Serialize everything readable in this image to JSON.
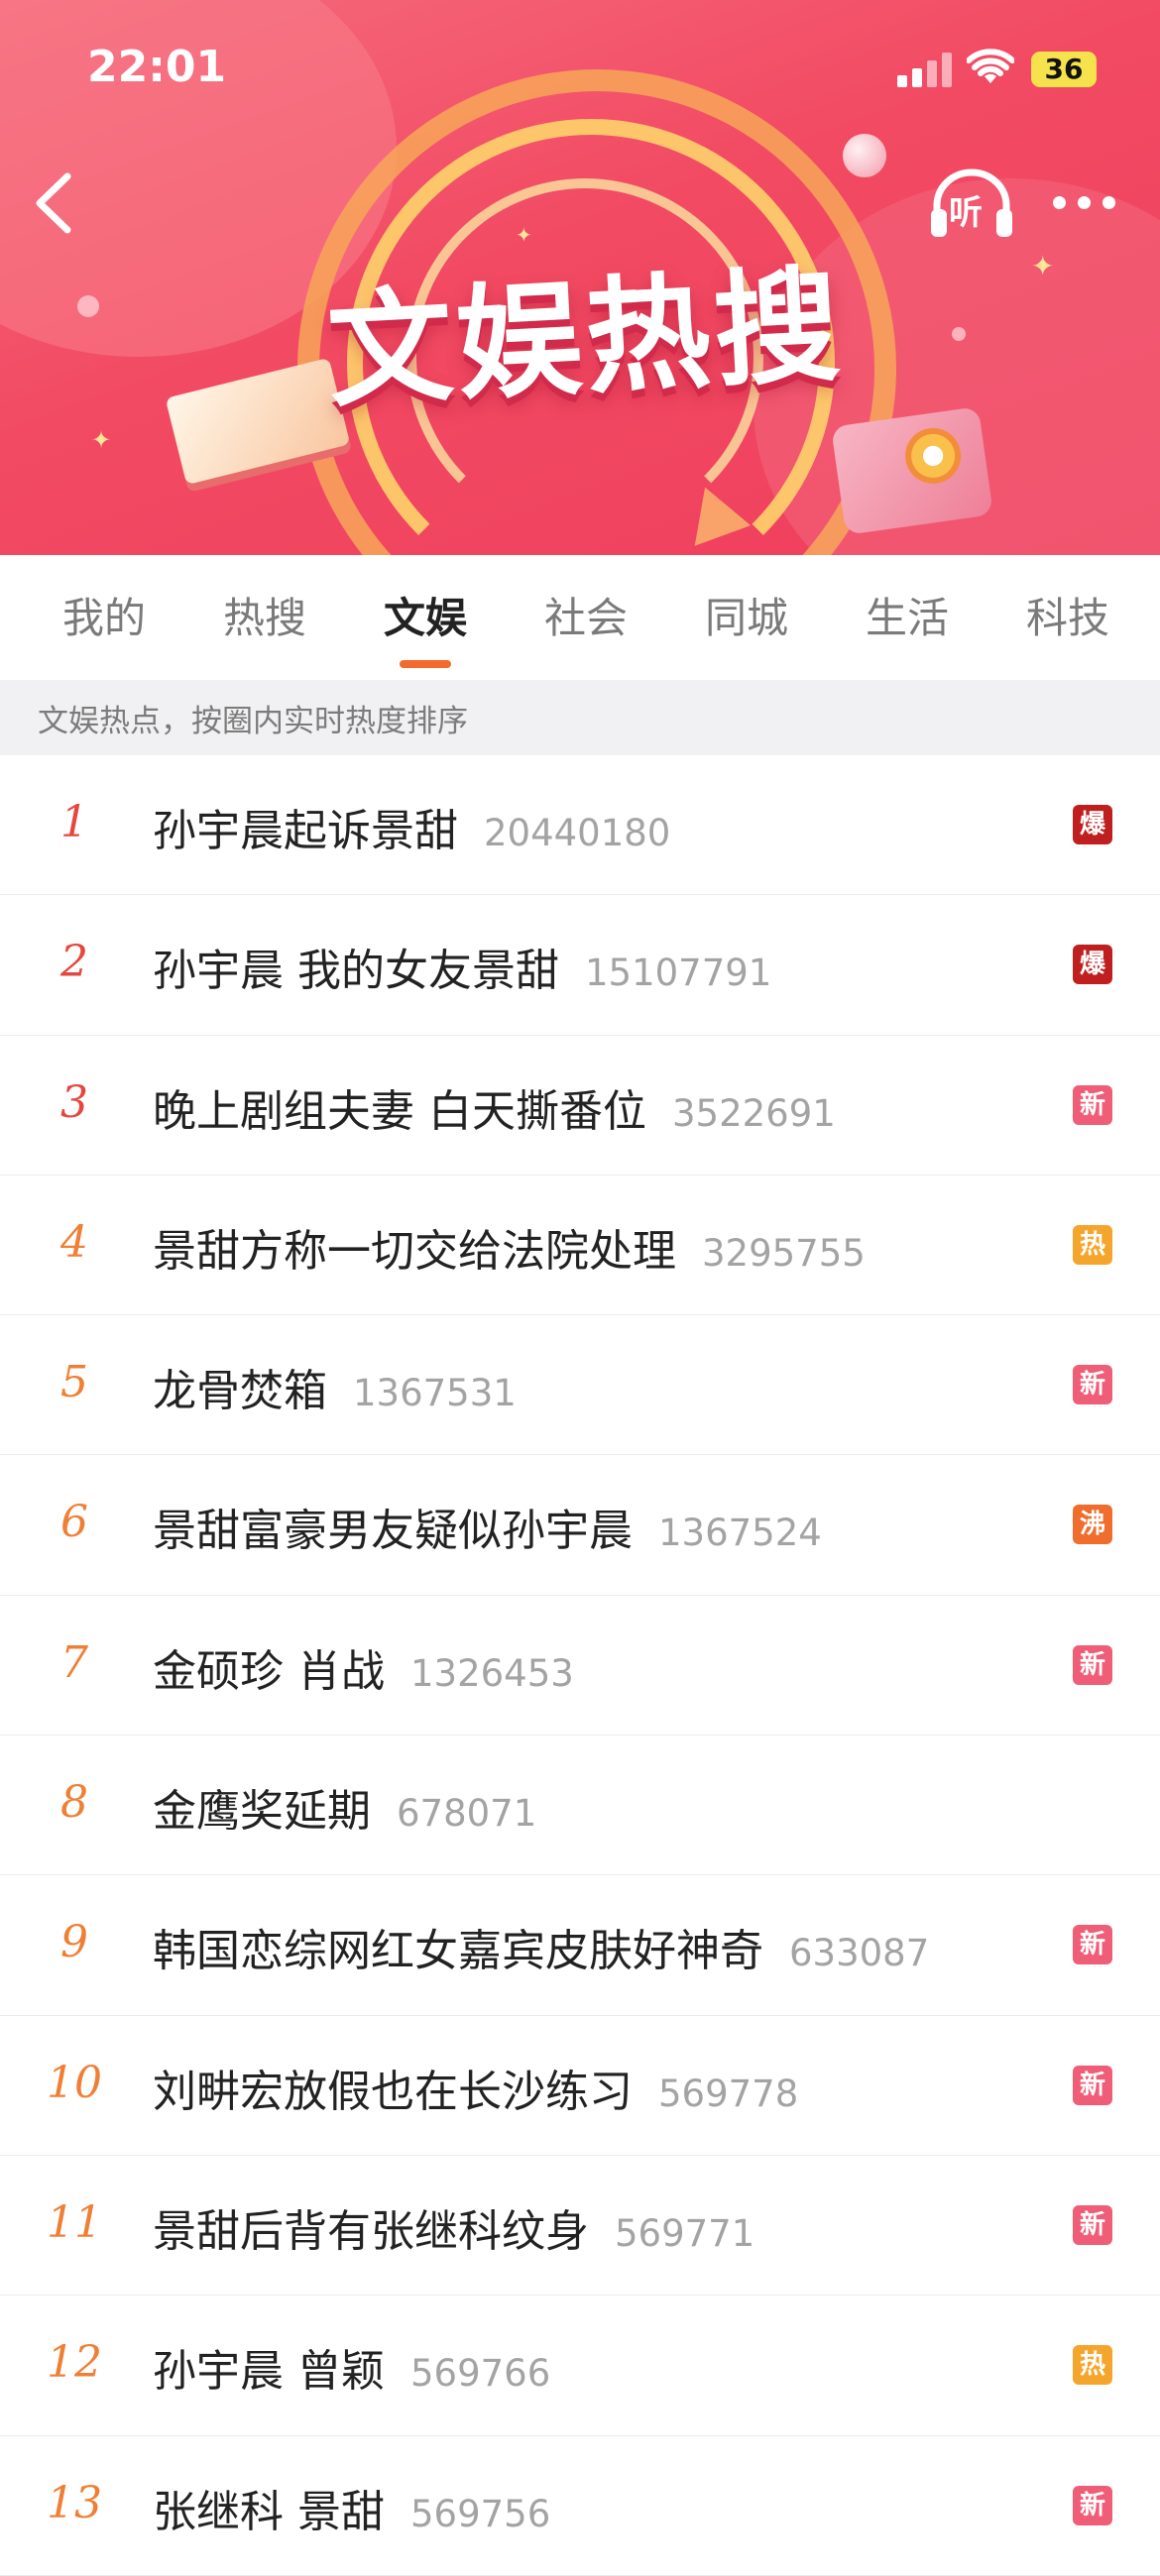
{
  "status_bar": {
    "time": "22:01",
    "battery": "36"
  },
  "header": {
    "banner_title": "文娱热搜",
    "listen_label": "听"
  },
  "colors": {
    "accent": "#f36a2c",
    "rank_red": "#e5473d",
    "rank_orange": "#ef7f35",
    "tag_bao": "#bf1f1f",
    "tag_xin": "#f05d76",
    "tag_re": "#f6a52c",
    "tag_fei": "#ef6d2d"
  },
  "tabs": [
    "我的",
    "热搜",
    "文娱",
    "社会",
    "同城",
    "生活",
    "科技"
  ],
  "active_tab": "文娱",
  "subtitle": "文娱热点，按圈内实时热度排序",
  "items": [
    {
      "rank": "1",
      "title": "孙宇晨起诉景甜",
      "count": "20440180",
      "tag": "爆"
    },
    {
      "rank": "2",
      "title": "孙宇晨 我的女友景甜",
      "count": "15107791",
      "tag": "爆"
    },
    {
      "rank": "3",
      "title": "晚上剧组夫妻 白天撕番位",
      "count": "3522691",
      "tag": "新"
    },
    {
      "rank": "4",
      "title": "景甜方称一切交给法院处理",
      "count": "3295755",
      "tag": "热"
    },
    {
      "rank": "5",
      "title": "龙骨焚箱",
      "count": "1367531",
      "tag": "新"
    },
    {
      "rank": "6",
      "title": "景甜富豪男友疑似孙宇晨",
      "count": "1367524",
      "tag": "沸"
    },
    {
      "rank": "7",
      "title": "金硕珍 肖战",
      "count": "1326453",
      "tag": "新"
    },
    {
      "rank": "8",
      "title": "金鹰奖延期",
      "count": "678071",
      "tag": ""
    },
    {
      "rank": "9",
      "title": "韩国恋综网红女嘉宾皮肤好神奇",
      "count": "633087",
      "tag": "新"
    },
    {
      "rank": "10",
      "title": "刘畊宏放假也在长沙练习",
      "count": "569778",
      "tag": "新"
    },
    {
      "rank": "11",
      "title": "景甜后背有张继科纹身",
      "count": "569771",
      "tag": "新"
    },
    {
      "rank": "12",
      "title": "孙宇晨 曾颖",
      "count": "569766",
      "tag": "热"
    },
    {
      "rank": "13",
      "title": "张继科 景甜",
      "count": "569756",
      "tag": "新"
    }
  ]
}
